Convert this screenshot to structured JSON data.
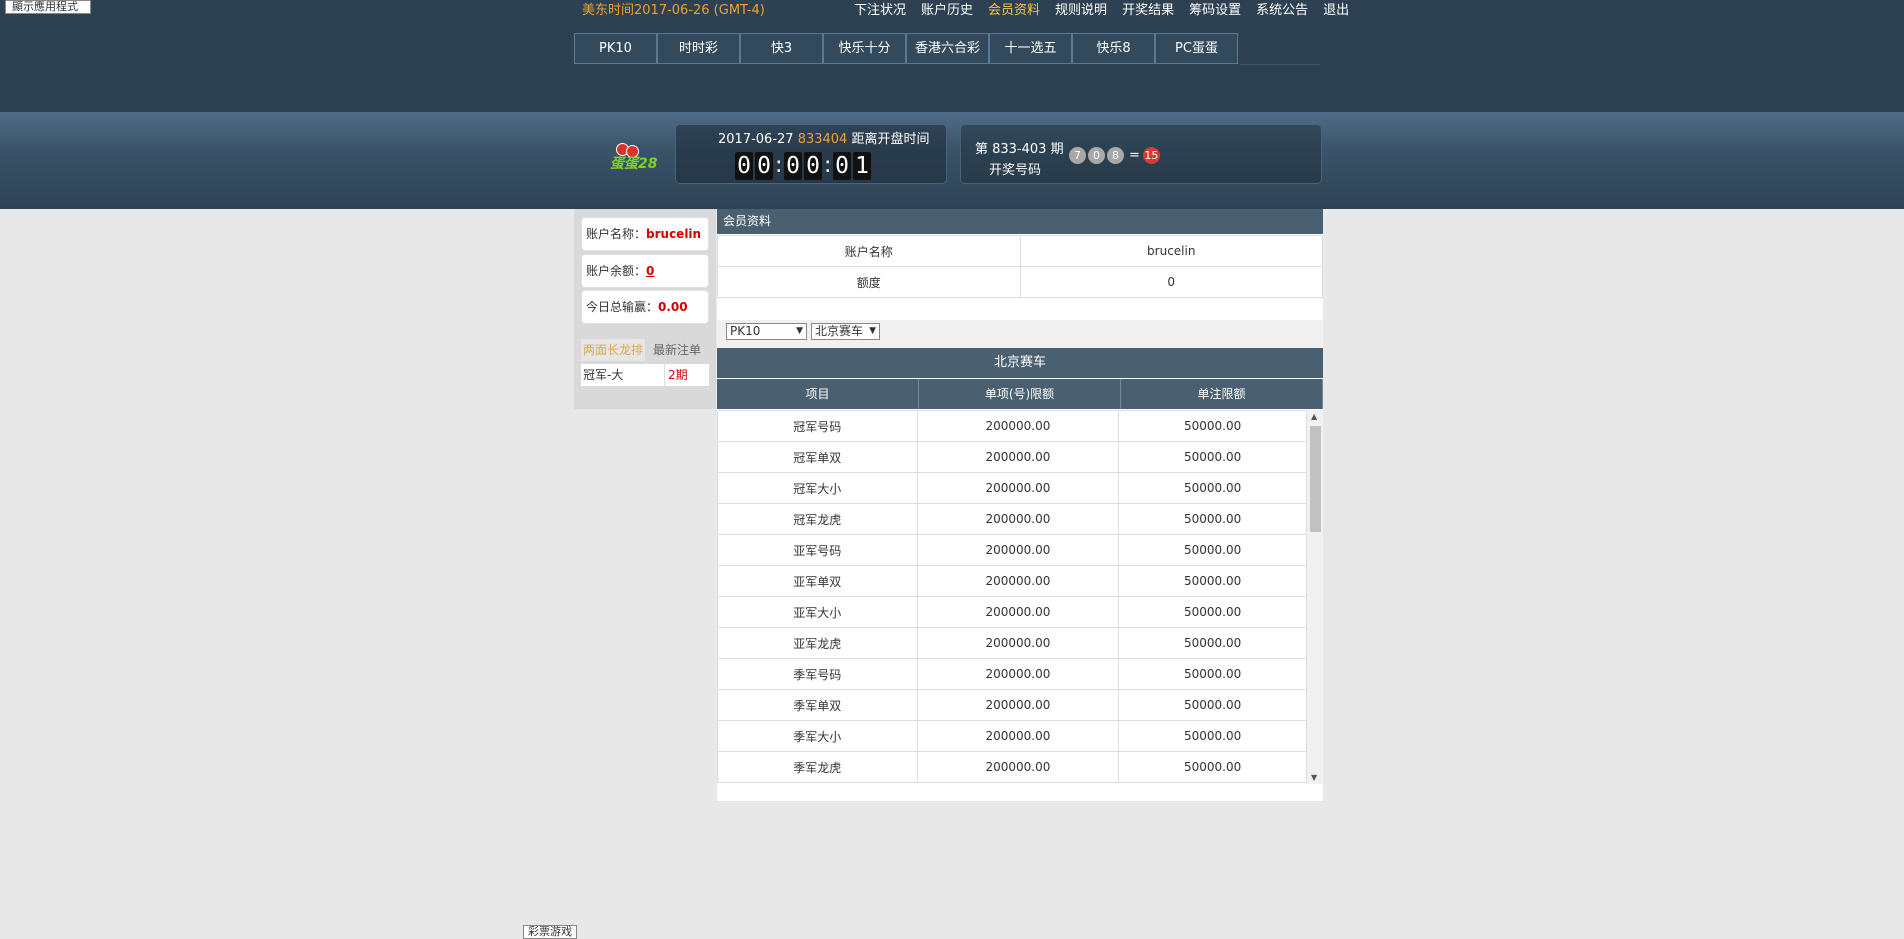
{
  "tooltip": "顯示應用程式",
  "header": {
    "time_label": "美东时间2017-06-26 (GMT-4)",
    "nav": [
      "下注状况",
      "账户历史",
      "会员资料",
      "规则说明",
      "开奖结果",
      "筹码设置",
      "系统公告",
      "退出"
    ],
    "active_nav": "会员资料",
    "game_tabs": [
      "PK10",
      "时时彩",
      "快3",
      "快乐十分",
      "香港六合彩",
      "十一选五",
      "快乐8",
      "PC蛋蛋"
    ]
  },
  "banner": {
    "logo_text": "蛋蛋28",
    "timer_date": "2017-06-27",
    "timer_issue": "833404",
    "timer_label": "距离开盘时间",
    "countdown": [
      "0",
      "0",
      "0",
      "0",
      "0",
      "1"
    ],
    "result_period": "第 833-403 期",
    "result_label": "开奖号码",
    "result_balls": [
      "7",
      "0",
      "8"
    ],
    "result_eq": "=",
    "result_sum": "15"
  },
  "left": {
    "account_label": "账户名称：",
    "account_value": "brucelin",
    "balance_label": "账户余额：",
    "balance_value": "0",
    "profit_label": "今日总输赢：",
    "profit_value": "0.00",
    "tabs": [
      "两面长龙排",
      "最新注单"
    ],
    "rank_row": {
      "name": "冠军-大",
      "periods": "2期"
    }
  },
  "main": {
    "section_title": "会员资料",
    "info_rows": [
      {
        "label": "账户名称",
        "value": "brucelin"
      },
      {
        "label": "额度",
        "value": "0"
      }
    ],
    "select_game": "PK10",
    "select_sub": "北京赛车",
    "table_title": "北京赛车",
    "columns": [
      "项目",
      "单项(号)限额",
      "单注限额"
    ],
    "rows": [
      [
        "冠军号码",
        "200000.00",
        "50000.00"
      ],
      [
        "冠军单双",
        "200000.00",
        "50000.00"
      ],
      [
        "冠军大小",
        "200000.00",
        "50000.00"
      ],
      [
        "冠军龙虎",
        "200000.00",
        "50000.00"
      ],
      [
        "亚军号码",
        "200000.00",
        "50000.00"
      ],
      [
        "亚军单双",
        "200000.00",
        "50000.00"
      ],
      [
        "亚军大小",
        "200000.00",
        "50000.00"
      ],
      [
        "亚军龙虎",
        "200000.00",
        "50000.00"
      ],
      [
        "季军号码",
        "200000.00",
        "50000.00"
      ],
      [
        "季军单双",
        "200000.00",
        "50000.00"
      ],
      [
        "季军大小",
        "200000.00",
        "50000.00"
      ],
      [
        "季军龙虎",
        "200000.00",
        "50000.00"
      ]
    ]
  },
  "footer_label": "彩票游戏"
}
